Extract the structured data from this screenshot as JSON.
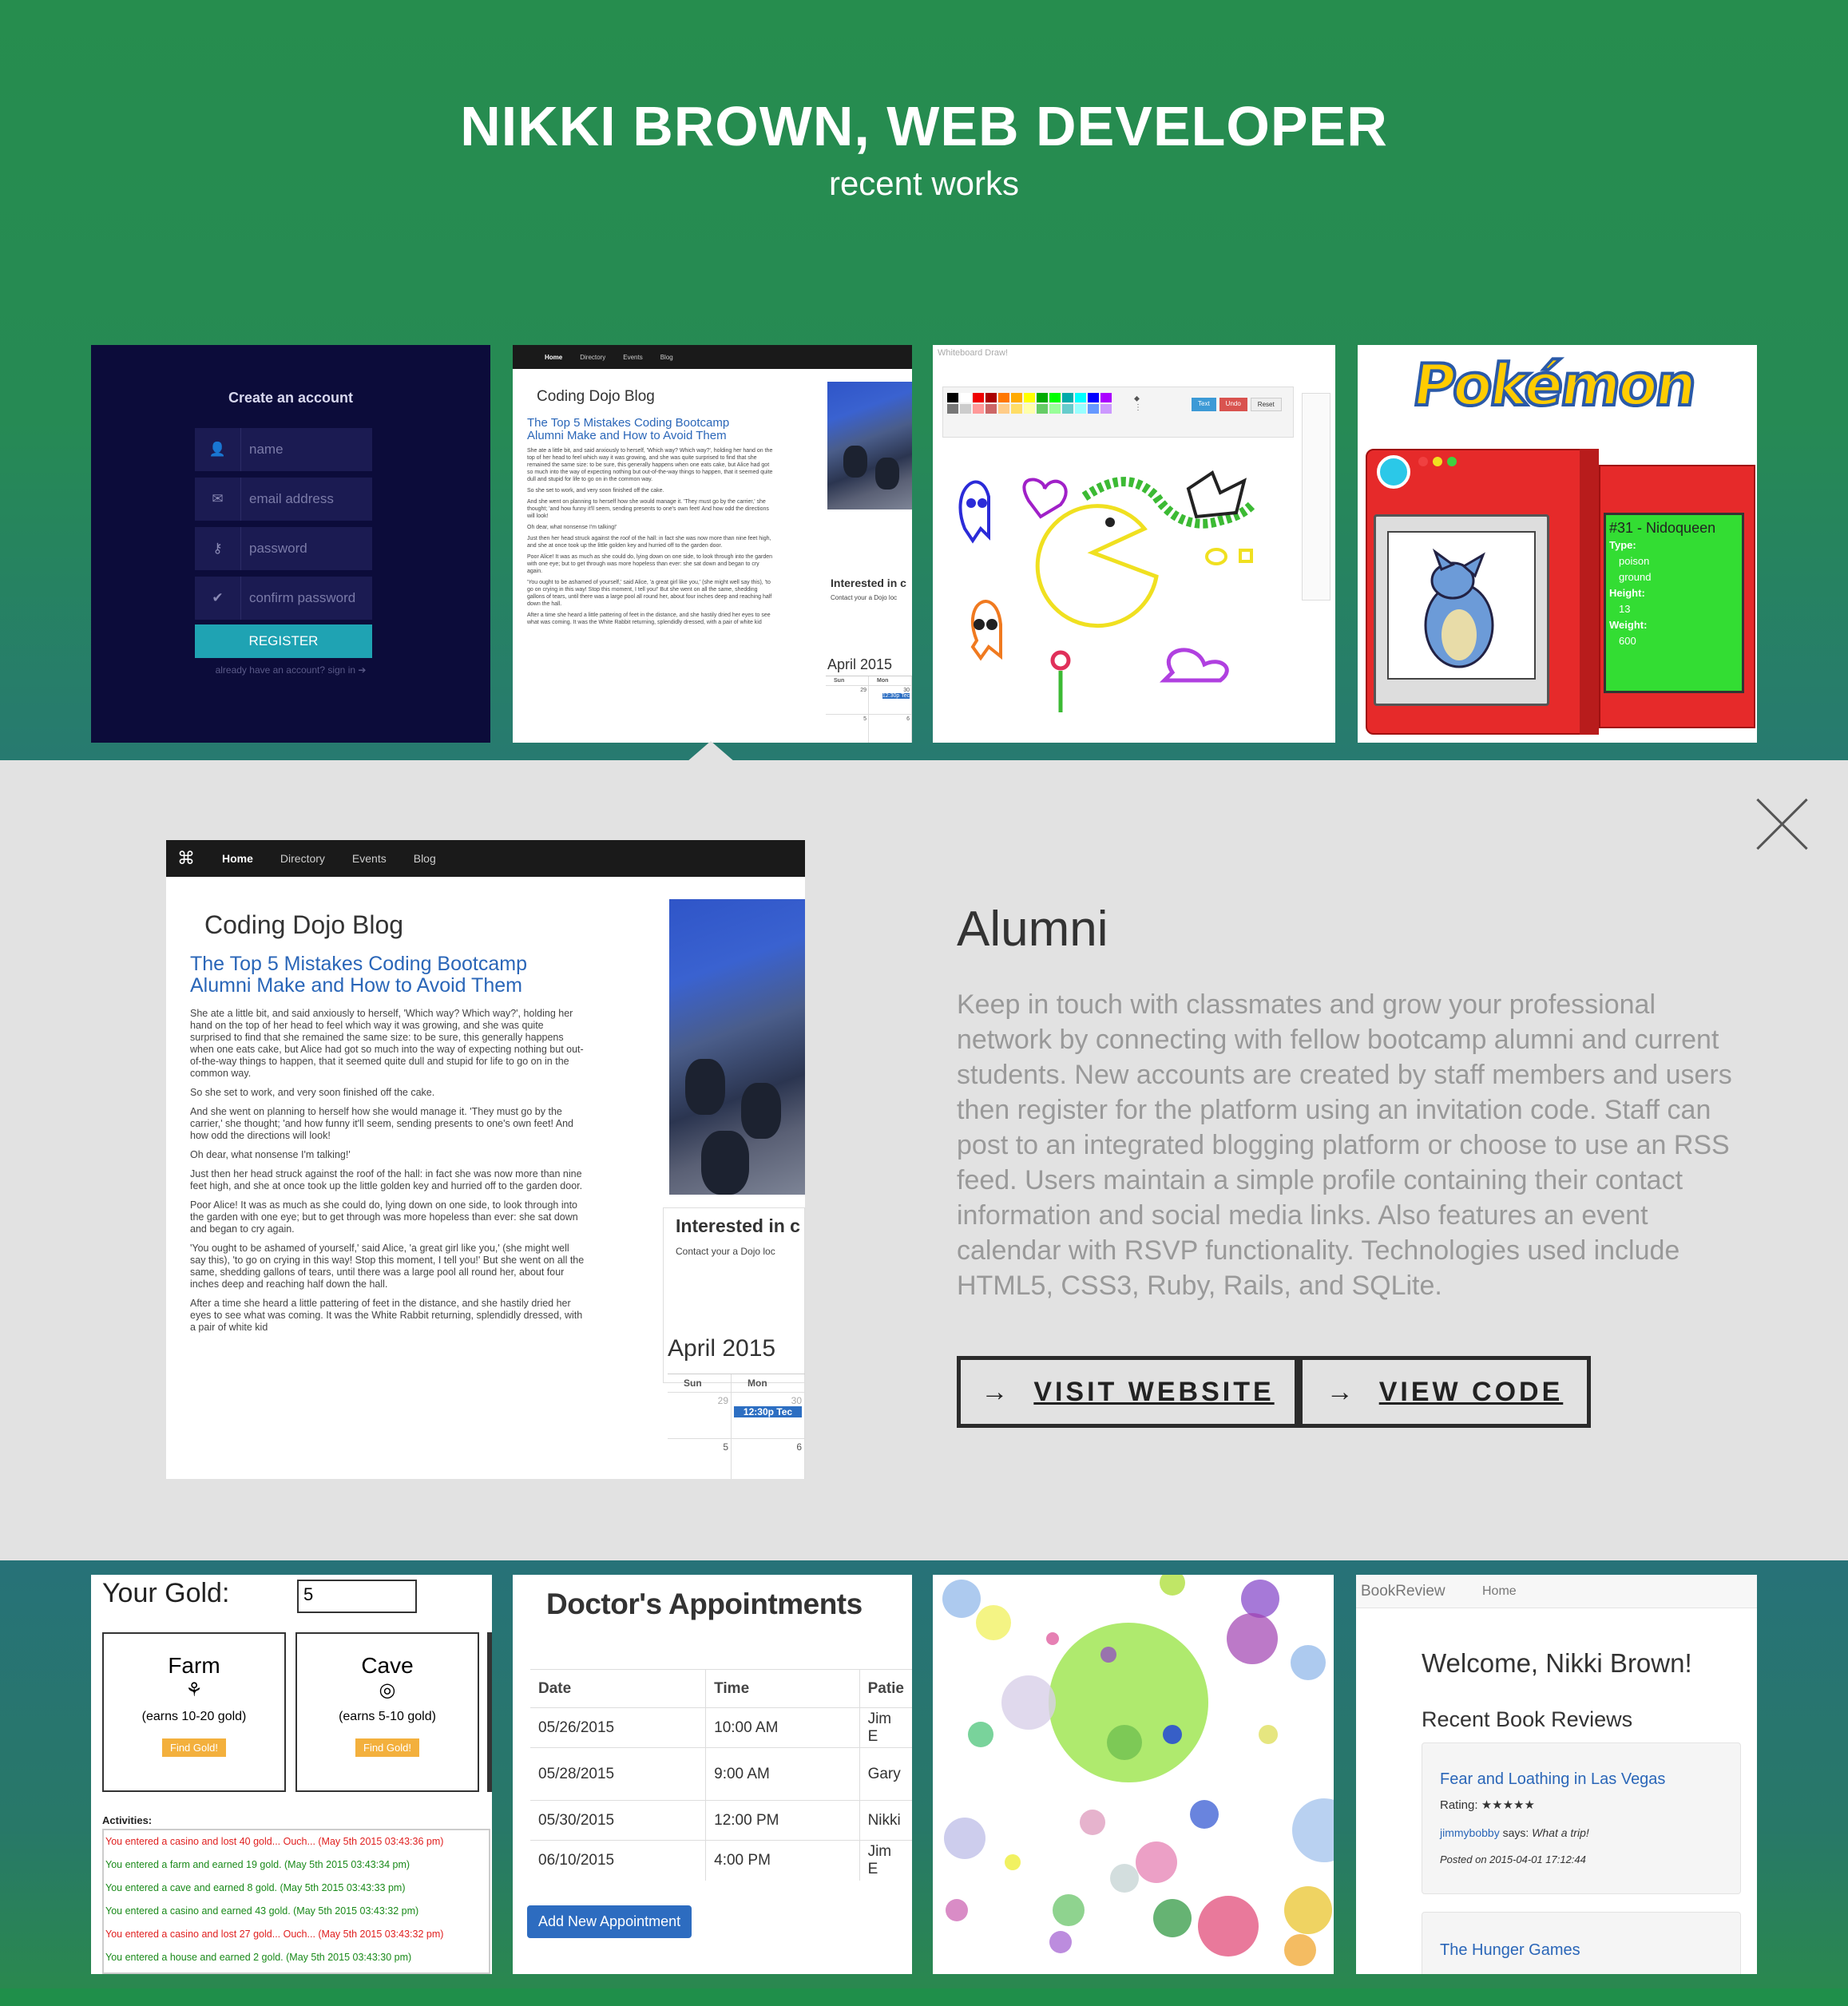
{
  "header": {
    "title": "NIKKI BROWN, WEB DEVELOPER",
    "subtitle": "recent works"
  },
  "thumbnails_top": {
    "login": {
      "heading": "Create an account",
      "fields": [
        "name",
        "email address",
        "password",
        "confirm password"
      ],
      "button": "REGISTER",
      "footnote": "already have an account? sign in ➔"
    },
    "blog": {
      "nav": [
        "Home",
        "Directory",
        "Events",
        "Blog"
      ],
      "heading": "Coding Dojo Blog",
      "post_title_1": "The Top 5 Mistakes Coding Bootcamp",
      "post_title_2": "Alumni Make and How to Avoid Them",
      "side_heading": "Interested in c",
      "side_text": "Contact your a Dojo loc",
      "calendar_title": "April 2015"
    },
    "paint": {
      "app_title": "Whiteboard Draw!",
      "buttons": [
        "Text",
        "Undo",
        "Reset"
      ]
    },
    "pokedex": {
      "logo": "Pokémon",
      "entry": "#31 - Nidoqueen",
      "type_label": "Type:",
      "types": [
        "poison",
        "ground"
      ],
      "height_label": "Height:",
      "height": "13",
      "weight_label": "Weight:",
      "weight": "600"
    }
  },
  "detail": {
    "title": "Alumni",
    "description": "Keep in touch with classmates and grow your professional network by connecting with fellow bootcamp alumni and current students. New accounts are created by staff members and users then register for the platform using an invitation code. Staff can post to an integrated blogging platform or choose to use an RSS feed. Users maintain a simple profile containing their contact information and social media links. Also features an event calendar with RSVP functionality. Technologies used include HTML5, CSS3, Ruby, Rails, and SQLite.",
    "visit_button": "VISIT WEBSITE",
    "code_button": "VIEW CODE",
    "arrow": "→",
    "preview": {
      "nav": [
        "Home",
        "Directory",
        "Events",
        "Blog"
      ],
      "heading": "Coding Dojo Blog",
      "post_title_1": "The Top 5 Mistakes Coding Bootcamp",
      "post_title_2": "Alumni Make and How to Avoid Them",
      "paragraphs": [
        "She ate a little bit, and said anxiously to herself, 'Which way? Which way?', holding her hand on the top of her head to feel which way it was growing, and she was quite surprised to find that she remained the same size: to be sure, this generally happens when one eats cake, but Alice had got so much into the way of expecting nothing but out-of-the-way things to happen, that it seemed quite dull and stupid for life to go on in the common way.",
        "So she set to work, and very soon finished off the cake.",
        "And she went on planning to herself how she would manage it. 'They must go by the carrier,' she thought; 'and how funny it'll seem, sending presents to one's own feet! And how odd the directions will look!",
        "Oh dear, what nonsense I'm talking!'",
        "Just then her head struck against the roof of the hall: in fact she was now more than nine feet high, and she at once took up the little golden key and hurried off to the garden door.",
        "Poor Alice! It was as much as she could do, lying down on one side, to look through into the garden with one eye; but to get through was more hopeless than ever: she sat down and began to cry again.",
        "'You ought to be ashamed of yourself,' said Alice, 'a great girl like you,' (she might well say this), 'to go on crying in this way! Stop this moment, I tell you!' But she went on all the same, shedding gallons of tears, until there was a large pool all round her, about four inches deep and reaching half down the hall.",
        "After a time she heard a little pattering of feet in the distance, and she hastily dried her eyes to see what was coming. It was the White Rabbit returning, splendidly dressed, with a pair of white kid"
      ],
      "side_heading": "Interested in c",
      "side_text": "Contact your a Dojo loc",
      "calendar_title": "April 2015",
      "calendar_days": [
        "Sun",
        "Mon"
      ],
      "calendar_nums": [
        "29",
        "30",
        "5",
        "6"
      ],
      "calendar_event": "12:30p Tec"
    }
  },
  "thumbnails_bottom": {
    "gold": {
      "label": "Your Gold:",
      "value": "5",
      "buildings": [
        {
          "name": "Farm",
          "icon": "⚘",
          "range": "(earns 10-20 gold)",
          "button": "Find Gold!"
        },
        {
          "name": "Cave",
          "icon": "◎",
          "range": "(earns 5-10 gold)",
          "button": "Find Gold!"
        }
      ],
      "activities_label": "Activities:",
      "activities": [
        {
          "text": "You entered a casino and lost 40 gold... Ouch... (May 5th 2015 03:43:36 pm)",
          "color": "#e02020"
        },
        {
          "text": "You entered a farm and earned 19 gold. (May 5th 2015 03:43:34 pm)",
          "color": "#1a8a1a"
        },
        {
          "text": "You entered a cave and earned 8 gold. (May 5th 2015 03:43:33 pm)",
          "color": "#1a8a1a"
        },
        {
          "text": "You entered a casino and earned 43 gold. (May 5th 2015 03:43:32 pm)",
          "color": "#1a8a1a"
        },
        {
          "text": "You entered a casino and lost 27 gold... Ouch... (May 5th 2015 03:43:32 pm)",
          "color": "#e02020"
        },
        {
          "text": "You entered a house and earned 2 gold. (May 5th 2015 03:43:30 pm)",
          "color": "#1a8a1a"
        }
      ]
    },
    "doctor": {
      "title": "Doctor's Appointments",
      "columns": [
        "Date",
        "Time",
        "Patie"
      ],
      "rows": [
        [
          "05/26/2015",
          "10:00 AM",
          "Jim E"
        ],
        [
          "05/28/2015",
          "9:00 AM",
          "Gary"
        ],
        [
          "05/30/2015",
          "12:00 PM",
          "Nikki"
        ],
        [
          "06/10/2015",
          "4:00 PM",
          "Jim E"
        ]
      ],
      "button": "Add New Appointment"
    },
    "bubbles": {},
    "bookreview": {
      "brand": "BookReview",
      "nav": "Home",
      "welcome": "Welcome, Nikki Brown!",
      "section": "Recent Book Reviews",
      "review1_title": "Fear and Loathing in Las Vegas",
      "rating_label": "Rating:",
      "rating_stars": "★★★★★",
      "reviewer": "jimmybobby",
      "says": " says: ",
      "quote": "What a trip!",
      "posted": "Posted on 2015-04-01 17:12:44",
      "review2_title": "The Hunger Games"
    }
  }
}
